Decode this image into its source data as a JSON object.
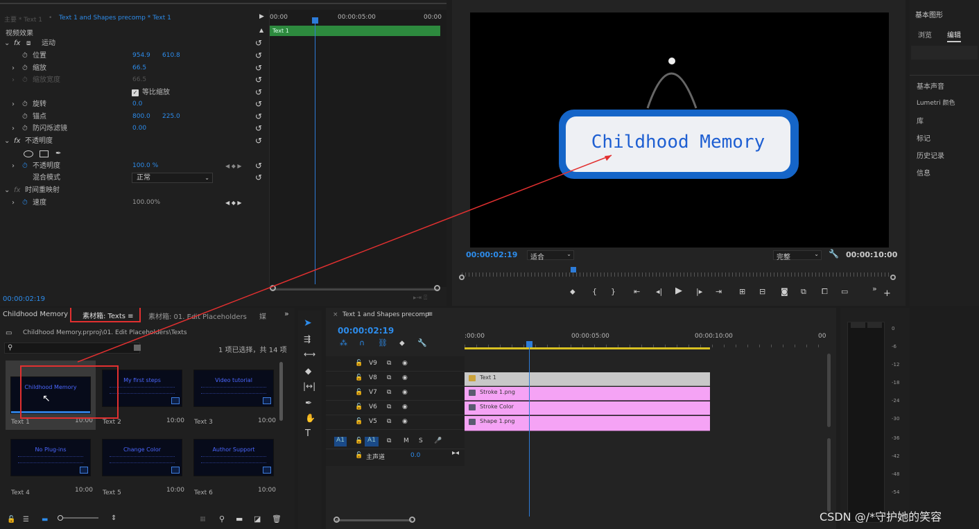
{
  "effect_controls": {
    "tab_master": "主要 * Text 1",
    "tab_active": "Text 1 and Shapes precomp * Text 1",
    "section_video": "视频效果",
    "motion": {
      "label": "运动"
    },
    "props": [
      {
        "label": "位置",
        "v1": "954.9",
        "v2": "610.8"
      },
      {
        "label": "缩放",
        "v1": "66.5"
      },
      {
        "label": "缩放宽度",
        "v1": "66.5"
      },
      {
        "label": "等比缩放"
      },
      {
        "label": "旋转",
        "v1": "0.0"
      },
      {
        "label": "锚点",
        "v1": "800.0",
        "v2": "225.0"
      },
      {
        "label": "防闪烁滤镜",
        "v1": "0.00"
      }
    ],
    "opacity": {
      "label": "不透明度",
      "prop": "不透明度",
      "value": "100.0 %",
      "blend_label": "混合模式",
      "blend_value": "正常"
    },
    "time_remap": {
      "label": "时间重映射",
      "prop": "速度",
      "value": "100.00%"
    },
    "ruler": [
      "00:00",
      "00:00:05:00",
      "00:00"
    ],
    "clip_label": "Text 1",
    "timecode": "00:00:02:19"
  },
  "program": {
    "title_text": "Childhood Memory",
    "timecode": "00:00:02:19",
    "fit": "适合",
    "quality": "完整",
    "duration": "00:00:10:00"
  },
  "right_panel": {
    "title": "基本图形",
    "tabs": [
      "浏览",
      "编辑"
    ],
    "items": [
      "基本声音",
      "Lumetri 颜色",
      "库",
      "标记",
      "历史记录",
      "信息"
    ]
  },
  "bins": {
    "tab_prev": "Childhood Memory",
    "tab_active": "素材箱: Texts",
    "tab_next": "素材箱: 01. Edit Placeholders",
    "tab_more": "媒",
    "path": "Childhood Memory.prproj\\01. Edit Placeholders\\Texts",
    "selection": "1 项已选择，共 14 项",
    "items": [
      {
        "title": "Childhood Memory",
        "label": "Text 1",
        "dur": "10:00"
      },
      {
        "title": "My first steps",
        "label": "Text 2",
        "dur": "10:00"
      },
      {
        "title": "Video tutorial",
        "label": "Text 3",
        "dur": "10:00"
      },
      {
        "title": "No Plug-ins",
        "label": "Text 4",
        "dur": "10:00"
      },
      {
        "title": "Change Color",
        "label": "Text 5",
        "dur": "10:00"
      },
      {
        "title": "Author Support",
        "label": "Text 6",
        "dur": "10:00"
      }
    ]
  },
  "timeline": {
    "seq_name": "Text 1 and Shapes precomp",
    "timecode": "00:00:02:19",
    "ruler": [
      ":00:00",
      "00:00:05:00",
      "00:00:10:00",
      "00"
    ],
    "tracks": [
      "V9",
      "V8",
      "V7",
      "V6",
      "V5"
    ],
    "audio_track": "A1",
    "master_label": "主声道",
    "master_value": "0.0",
    "clips": [
      "Text 1",
      "Stroke 1.png",
      "Stroke Color",
      "Shape 1.png"
    ]
  },
  "meter": [
    "0",
    "-6",
    "-12",
    "-18",
    "-24",
    "-30",
    "-36",
    "-42",
    "-48",
    "-54"
  ],
  "watermark": "CSDN @/*守护她的笑容"
}
